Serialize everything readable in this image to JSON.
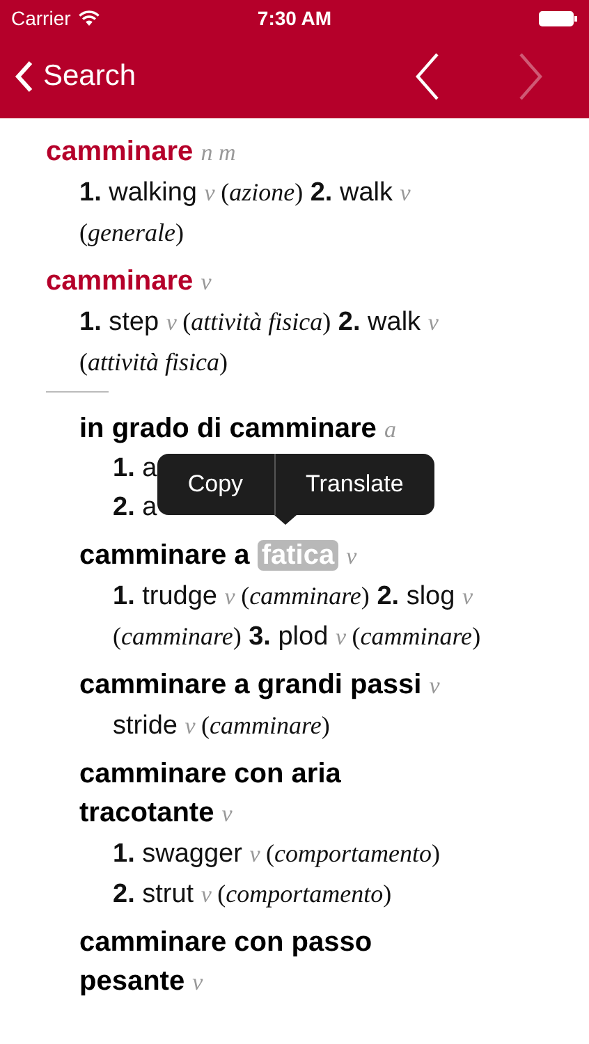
{
  "status_bar": {
    "carrier": "Carrier",
    "time": "7:30 AM"
  },
  "nav_bar": {
    "back_label": "Search",
    "previous": {
      "disabled": false
    },
    "next": {
      "disabled": true
    }
  },
  "entries": [
    {
      "kind": "main",
      "headword": [
        {
          "text": "camminare",
          "selected": false
        }
      ],
      "pos": "n m",
      "senses": [
        [
          {
            "num": "1.",
            "word": "walking",
            "pos": "v",
            "context": "(*azione*)"
          },
          {
            "num": "2.",
            "word": "walk",
            "pos": "v",
            "context": "(*generale*)"
          }
        ]
      ]
    },
    {
      "kind": "main",
      "headword": [
        {
          "text": "camminare",
          "selected": false
        }
      ],
      "pos": "v",
      "senses": [
        [
          {
            "num": "1.",
            "word": "step",
            "pos": "v",
            "context": "(*attività fisica*)"
          },
          {
            "num": "2.",
            "word": "walk",
            "pos": "v",
            "context": "(*attività fisica*)"
          }
        ]
      ]
    },
    {
      "kind": "divider"
    },
    {
      "kind": "sub",
      "headword": [
        {
          "text": "in grado di camminare",
          "selected": false
        }
      ],
      "pos": "a",
      "senses": [
        [
          {
            "num": "1.",
            "word": "a"
          }
        ],
        [
          {
            "num": "2.",
            "word": "a"
          }
        ]
      ]
    },
    {
      "kind": "sub",
      "headword": [
        {
          "text": "camminare a",
          "selected": false
        },
        {
          "text": "fatica",
          "selected": true
        }
      ],
      "pos": "v",
      "senses": [
        [
          {
            "num": "1.",
            "word": "trudge",
            "pos": "v",
            "context": "(*camminare*)"
          },
          {
            "num": "2.",
            "word": "slog",
            "pos": "v",
            "context": "(*camminare*)"
          },
          {
            "num": "3.",
            "word": "plod",
            "pos": "v",
            "context": "(*camminare*)"
          }
        ]
      ]
    },
    {
      "kind": "sub",
      "headword": [
        {
          "text": "camminare a grandi passi",
          "selected": false
        }
      ],
      "pos": "v",
      "senses": [
        [
          {
            "word": "stride",
            "pos": "v",
            "context": "(*camminare*)"
          }
        ]
      ]
    },
    {
      "kind": "sub",
      "headword": [
        {
          "text": "camminare con aria tracotante",
          "selected": false
        }
      ],
      "pos": "v",
      "senses": [
        [
          {
            "num": "1.",
            "word": "swagger",
            "pos": "v",
            "context": "(*comportamento*)"
          }
        ],
        [
          {
            "num": "2.",
            "word": "strut",
            "pos": "v",
            "context": "(*comportamento*)"
          }
        ]
      ]
    },
    {
      "kind": "sub",
      "headword": [
        {
          "text": "camminare con passo pesante",
          "selected": false
        }
      ],
      "pos": "v"
    }
  ],
  "popup_menu": {
    "items": [
      "Copy",
      "Translate"
    ]
  }
}
